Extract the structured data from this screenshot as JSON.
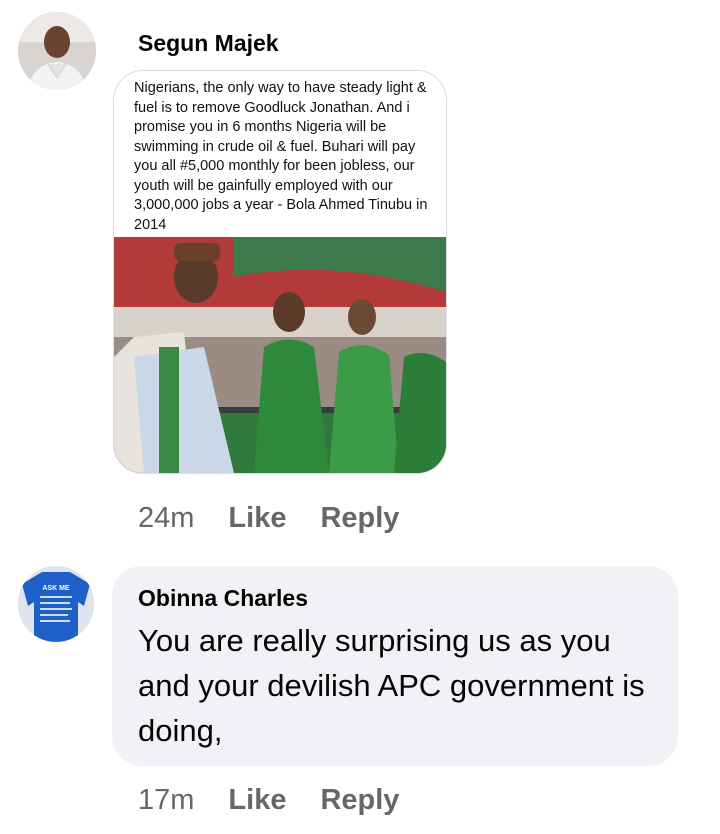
{
  "comments": [
    {
      "author": "Segun Majek",
      "post_text": "Nigerians, the only way to have steady light & fuel is to remove Goodluck Jonathan. And i promise you in 6 months Nigeria will be swimming in crude oil & fuel. Buhari will pay you all #5,000 monthly for been jobless, our youth will be gainfully employed with our 3,000,000 jobs a year - Bola Ahmed Tinubu in 2014",
      "time": "24m",
      "like_label": "Like",
      "reply_label": "Reply"
    },
    {
      "author": "Obinna Charles",
      "text": "You are really surprising us as you and your devilish APC government is doing,",
      "time": "17m",
      "like_label": "Like",
      "reply_label": "Reply",
      "avatar_shirt_text": "ASK ME"
    }
  ],
  "colors": {
    "meta_gray": "#65676b",
    "bubble_bg": "#f0f2f5",
    "avatar2_shirt": "#1f5fc8"
  }
}
